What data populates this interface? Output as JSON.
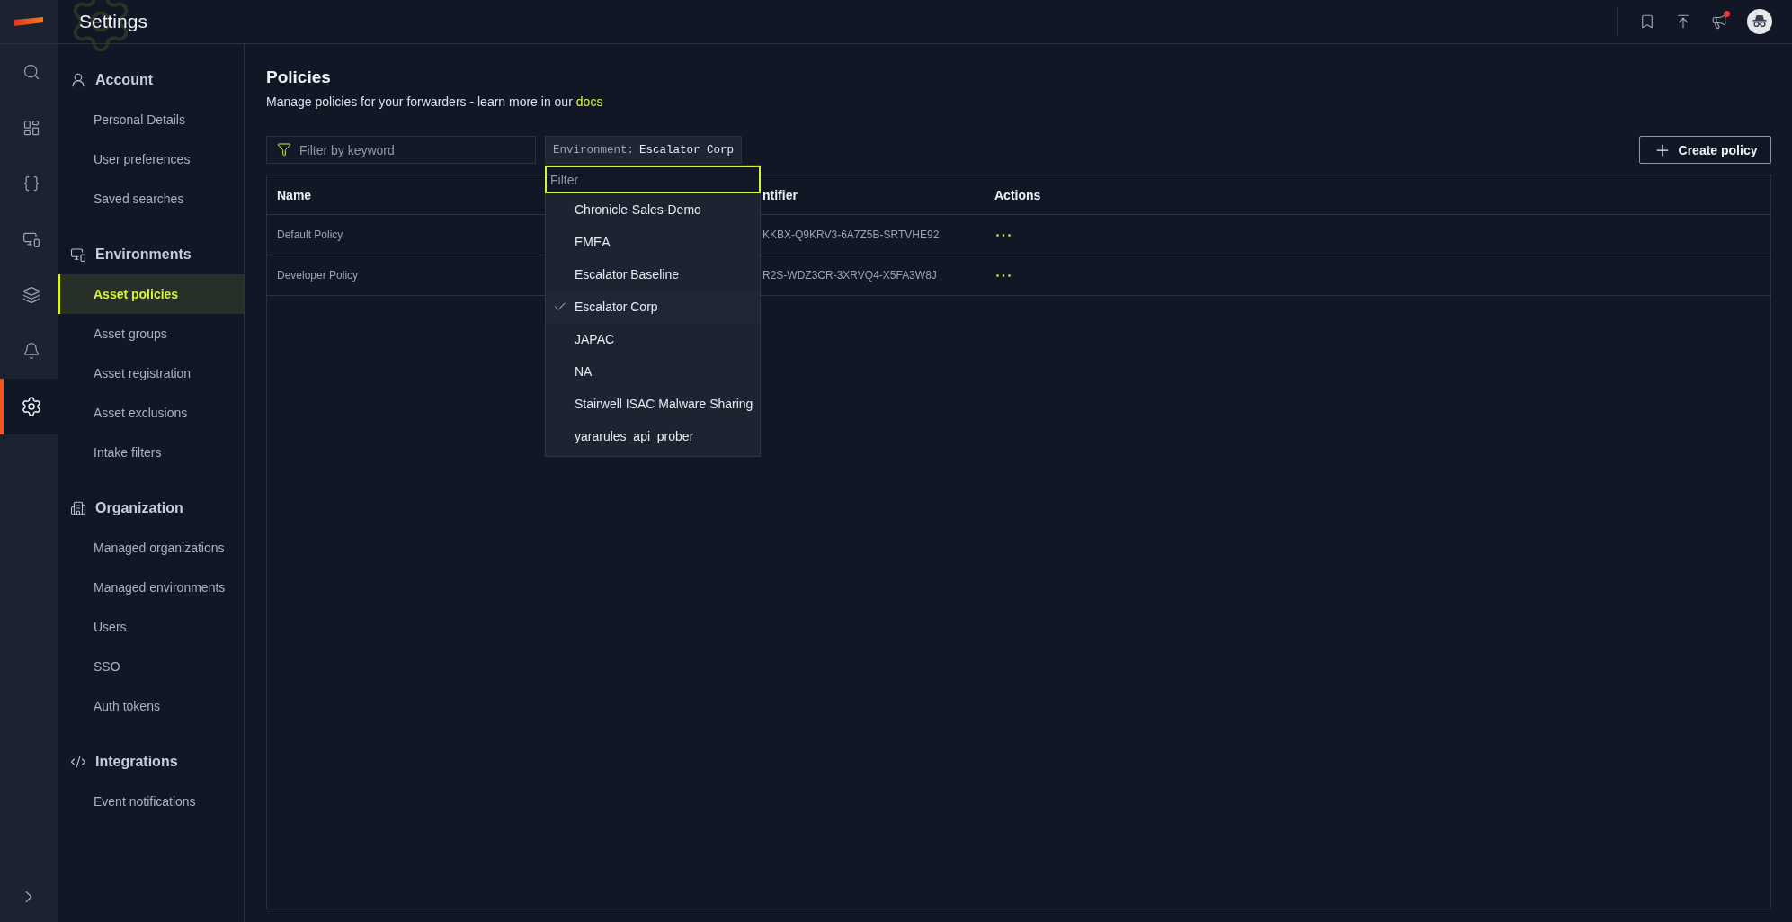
{
  "app": {
    "title": "Settings"
  },
  "header_actions": [
    {
      "kind": "bookmark",
      "unread": false
    },
    {
      "kind": "upload",
      "unread": false
    },
    {
      "kind": "megaphone",
      "unread": true
    },
    {
      "kind": "avatar",
      "unread": false
    }
  ],
  "rail": [
    {
      "kind": "search",
      "selected": false
    },
    {
      "kind": "dashboard",
      "selected": false
    },
    {
      "kind": "braces",
      "selected": false
    },
    {
      "kind": "devices",
      "selected": false
    },
    {
      "kind": "layers",
      "selected": false
    },
    {
      "kind": "bell",
      "selected": false
    },
    {
      "kind": "settings",
      "selected": true
    }
  ],
  "sidebar": [
    {
      "title": "Account",
      "kind": "user",
      "items": [
        {
          "label": "Personal Details",
          "selected": false
        },
        {
          "label": "User preferences",
          "selected": false
        },
        {
          "label": "Saved searches",
          "selected": false
        }
      ]
    },
    {
      "title": "Environments",
      "kind": "devices",
      "items": [
        {
          "label": "Asset policies",
          "selected": true
        },
        {
          "label": "Asset groups",
          "selected": false
        },
        {
          "label": "Asset registration",
          "selected": false
        },
        {
          "label": "Asset exclusions",
          "selected": false
        },
        {
          "label": "Intake filters",
          "selected": false
        }
      ]
    },
    {
      "title": "Organization",
      "kind": "building",
      "items": [
        {
          "label": "Managed organizations",
          "selected": false
        },
        {
          "label": "Managed environments",
          "selected": false
        },
        {
          "label": "Users",
          "selected": false
        },
        {
          "label": "SSO",
          "selected": false
        },
        {
          "label": "Auth tokens",
          "selected": false
        }
      ]
    },
    {
      "title": "Integrations",
      "kind": "code",
      "items": [
        {
          "label": "Event notifications",
          "selected": false
        }
      ]
    }
  ],
  "page": {
    "title": "Policies",
    "description": "Manage policies for your forwarders - learn more in our",
    "link": "docs"
  },
  "filter": {
    "placeholder": "Filter by keyword"
  },
  "environment": {
    "label": "Environment:",
    "value": "Escalator Corp"
  },
  "create_button": "Create policy",
  "table": {
    "columns": [
      "Name",
      "ntifier",
      "Actions"
    ],
    "rows": [
      {
        "name": "Default Policy",
        "column_2": "KKBX-Q9KRV3-6A7Z5B-SRTVHE92"
      },
      {
        "name": "Developer Policy",
        "column_2": "R2S-WDZ3CR-3XRVQ4-X5FA3W8J"
      }
    ]
  },
  "dropdown": {
    "placeholder": "Filter",
    "options": [
      {
        "label": "Chronicle-Sales-Demo",
        "selected": false
      },
      {
        "label": "EMEA",
        "selected": false
      },
      {
        "label": "Escalator Baseline",
        "selected": false
      },
      {
        "label": "Escalator Corp",
        "selected": true
      },
      {
        "label": "JAPAC",
        "selected": false
      },
      {
        "label": "NA",
        "selected": false
      },
      {
        "label": "Stairwell ISAC Malware Sharing",
        "selected": false
      },
      {
        "label": "yararules_api_prober",
        "selected": false
      }
    ]
  }
}
